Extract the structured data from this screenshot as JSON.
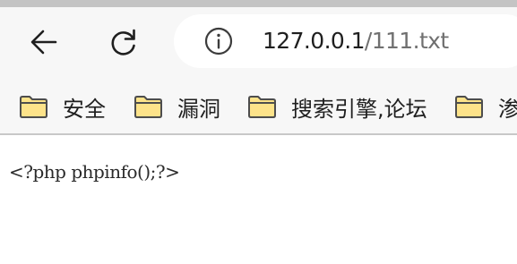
{
  "browser": {
    "address_bar": {
      "url_host": "127.0.0.1",
      "url_path": "/111.txt"
    },
    "bookmarks": [
      {
        "label": "安全",
        "icon": "folder-icon"
      },
      {
        "label": "漏洞",
        "icon": "folder-icon"
      },
      {
        "label": "搜索引擎,论坛",
        "icon": "folder-icon"
      },
      {
        "label": "渗",
        "icon": "folder-icon"
      }
    ]
  },
  "page": {
    "text": "<?php phpinfo();?>"
  },
  "colors": {
    "toolbar_bg": "#f7f7f7",
    "folder_fill": "#fde38a",
    "folder_stroke": "#4d4d4d"
  }
}
